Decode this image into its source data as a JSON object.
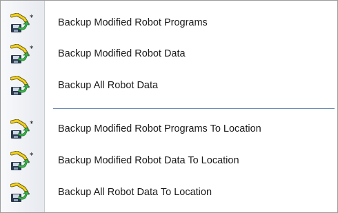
{
  "menu": {
    "items": [
      {
        "label": "Backup Modified Robot Programs",
        "icon": "robot-backup-modified-icon",
        "modified": true
      },
      {
        "label": "Backup Modified Robot Data",
        "icon": "robot-backup-modified-icon",
        "modified": true
      },
      {
        "label": "Backup All Robot Data",
        "icon": "robot-backup-icon",
        "modified": false
      },
      {
        "label": "Backup Modified Robot Programs To Location",
        "icon": "robot-backup-modified-icon",
        "modified": true
      },
      {
        "label": "Backup Modified Robot Data To Location",
        "icon": "robot-backup-modified-icon",
        "modified": true
      },
      {
        "label": "Backup All Robot Data To Location",
        "icon": "robot-backup-icon",
        "modified": false
      }
    ]
  },
  "colors": {
    "arm_yellow": "#f2d31a",
    "arm_outline": "#6a5a10",
    "arrow_green": "#3bb54a",
    "disk_dark": "#2a3a4f",
    "separator": "#6d8bb3",
    "gutter": "#e7eaf0"
  }
}
